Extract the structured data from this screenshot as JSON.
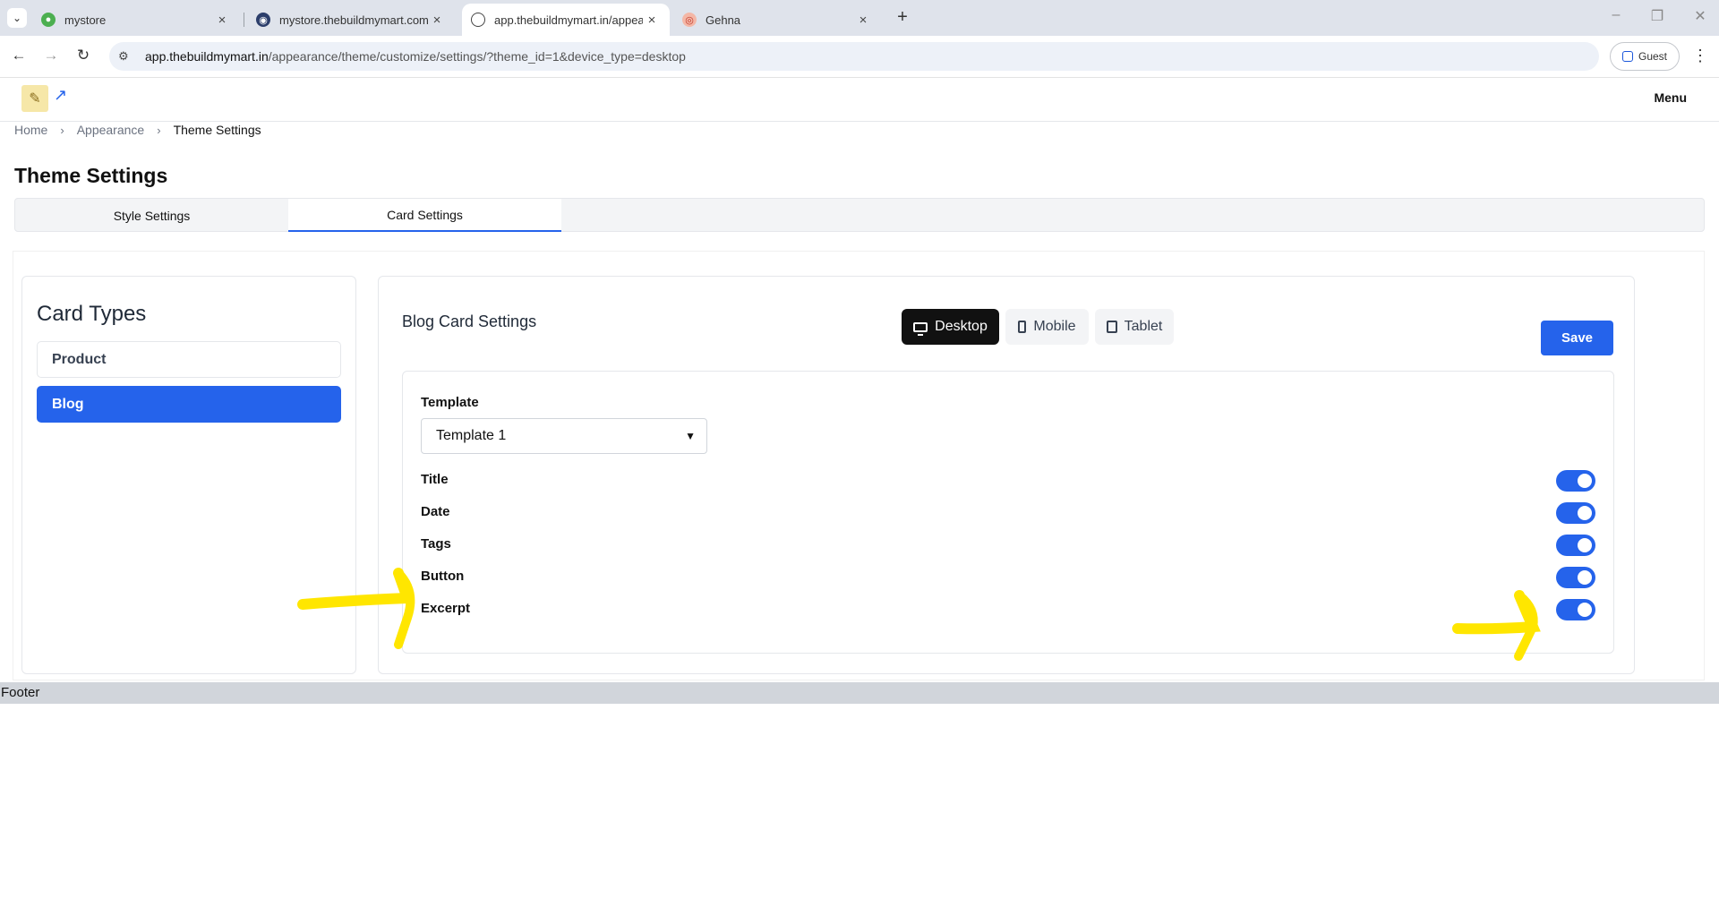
{
  "browser": {
    "tabs": [
      {
        "label": "mystore",
        "active": false
      },
      {
        "label": "mystore.thebuildmymart.com",
        "active": false
      },
      {
        "label": "app.thebuildmymart.in/appeara",
        "active": true
      },
      {
        "label": "Gehna",
        "active": false
      }
    ],
    "url_host": "app.thebuildmymart.in",
    "url_path": "/appearance/theme/customize/settings/?theme_id=1&device_type=desktop",
    "profile_label": "Guest"
  },
  "header": {
    "menu_label": "Menu"
  },
  "breadcrumb": [
    "Home",
    "Appearance",
    "Theme Settings"
  ],
  "page_title": "Theme Settings",
  "settings_tabs": [
    {
      "label": "Style Settings",
      "active": false
    },
    {
      "label": "Card Settings",
      "active": true
    }
  ],
  "card_types": {
    "heading": "Card Types",
    "items": [
      {
        "label": "Product",
        "active": false
      },
      {
        "label": "Blog",
        "active": true
      }
    ]
  },
  "blog_settings": {
    "title": "Blog Card Settings",
    "devices": [
      {
        "label": "Desktop",
        "icon": "desktop-icon",
        "active": true
      },
      {
        "label": "Mobile",
        "icon": "mobile-icon",
        "active": false
      },
      {
        "label": "Tablet",
        "icon": "tablet-icon",
        "active": false
      }
    ],
    "save_label": "Save",
    "template_label": "Template",
    "template_value": "Template 1",
    "options": [
      {
        "label": "Title",
        "enabled": true
      },
      {
        "label": "Date",
        "enabled": true
      },
      {
        "label": "Tags",
        "enabled": true
      },
      {
        "label": "Button",
        "enabled": true
      },
      {
        "label": "Excerpt",
        "enabled": true
      }
    ]
  },
  "footer": {
    "label": "Footer"
  },
  "colors": {
    "accent": "#2563eb",
    "annotation": "#ffe600",
    "device_active_bg": "#111111"
  }
}
